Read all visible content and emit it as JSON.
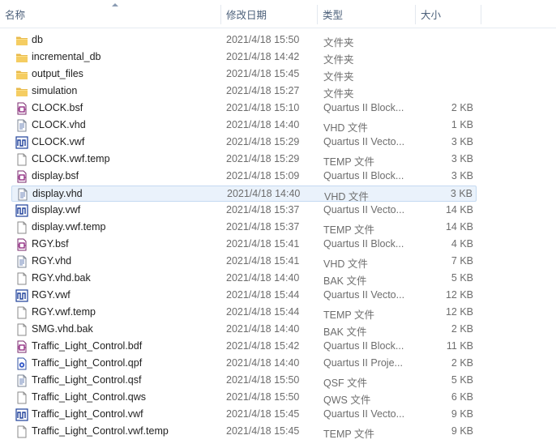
{
  "header": {
    "name": "名称",
    "date": "修改日期",
    "type": "类型",
    "size": "大小"
  },
  "files": [
    {
      "name": "db",
      "date": "2021/4/18 15:50",
      "type": "文件夹",
      "size": "",
      "icon": "folder"
    },
    {
      "name": "incremental_db",
      "date": "2021/4/18 14:42",
      "type": "文件夹",
      "size": "",
      "icon": "folder"
    },
    {
      "name": "output_files",
      "date": "2021/4/18 15:45",
      "type": "文件夹",
      "size": "",
      "icon": "folder"
    },
    {
      "name": "simulation",
      "date": "2021/4/18 15:27",
      "type": "文件夹",
      "size": "",
      "icon": "folder"
    },
    {
      "name": "CLOCK.bsf",
      "date": "2021/4/18 15:10",
      "type": "Quartus II Block...",
      "size": "2 KB",
      "icon": "quartus-block"
    },
    {
      "name": "CLOCK.vhd",
      "date": "2021/4/18 14:40",
      "type": "VHD 文件",
      "size": "1 KB",
      "icon": "vhd"
    },
    {
      "name": "CLOCK.vwf",
      "date": "2021/4/18 15:29",
      "type": "Quartus II Vecto...",
      "size": "3 KB",
      "icon": "waveform"
    },
    {
      "name": "CLOCK.vwf.temp",
      "date": "2021/4/18 15:29",
      "type": "TEMP 文件",
      "size": "3 KB",
      "icon": "blank"
    },
    {
      "name": "display.bsf",
      "date": "2021/4/18 15:09",
      "type": "Quartus II Block...",
      "size": "3 KB",
      "icon": "quartus-block"
    },
    {
      "name": "display.vhd",
      "date": "2021/4/18 14:40",
      "type": "VHD 文件",
      "size": "3 KB",
      "icon": "vhd",
      "selected": true
    },
    {
      "name": "display.vwf",
      "date": "2021/4/18 15:37",
      "type": "Quartus II Vecto...",
      "size": "14 KB",
      "icon": "waveform"
    },
    {
      "name": "display.vwf.temp",
      "date": "2021/4/18 15:37",
      "type": "TEMP 文件",
      "size": "14 KB",
      "icon": "blank"
    },
    {
      "name": "RGY.bsf",
      "date": "2021/4/18 15:41",
      "type": "Quartus II Block...",
      "size": "4 KB",
      "icon": "quartus-block"
    },
    {
      "name": "RGY.vhd",
      "date": "2021/4/18 15:41",
      "type": "VHD 文件",
      "size": "7 KB",
      "icon": "vhd"
    },
    {
      "name": "RGY.vhd.bak",
      "date": "2021/4/18 14:40",
      "type": "BAK 文件",
      "size": "5 KB",
      "icon": "blank"
    },
    {
      "name": "RGY.vwf",
      "date": "2021/4/18 15:44",
      "type": "Quartus II Vecto...",
      "size": "12 KB",
      "icon": "waveform"
    },
    {
      "name": "RGY.vwf.temp",
      "date": "2021/4/18 15:44",
      "type": "TEMP 文件",
      "size": "12 KB",
      "icon": "blank"
    },
    {
      "name": "SMG.vhd.bak",
      "date": "2021/4/18 14:40",
      "type": "BAK 文件",
      "size": "2 KB",
      "icon": "blank"
    },
    {
      "name": "Traffic_Light_Control.bdf",
      "date": "2021/4/18 15:42",
      "type": "Quartus II Block...",
      "size": "11 KB",
      "icon": "quartus-block"
    },
    {
      "name": "Traffic_Light_Control.qpf",
      "date": "2021/4/18 14:40",
      "type": "Quartus II Proje...",
      "size": "2 KB",
      "icon": "quartus-project"
    },
    {
      "name": "Traffic_Light_Control.qsf",
      "date": "2021/4/18 15:50",
      "type": "QSF 文件",
      "size": "5 KB",
      "icon": "vhd"
    },
    {
      "name": "Traffic_Light_Control.qws",
      "date": "2021/4/18 15:50",
      "type": "QWS 文件",
      "size": "6 KB",
      "icon": "blank"
    },
    {
      "name": "Traffic_Light_Control.vwf",
      "date": "2021/4/18 15:45",
      "type": "Quartus II Vecto...",
      "size": "9 KB",
      "icon": "waveform"
    },
    {
      "name": "Traffic_Light_Control.vwf.temp",
      "date": "2021/4/18 15:45",
      "type": "TEMP 文件",
      "size": "9 KB",
      "icon": "blank"
    }
  ]
}
